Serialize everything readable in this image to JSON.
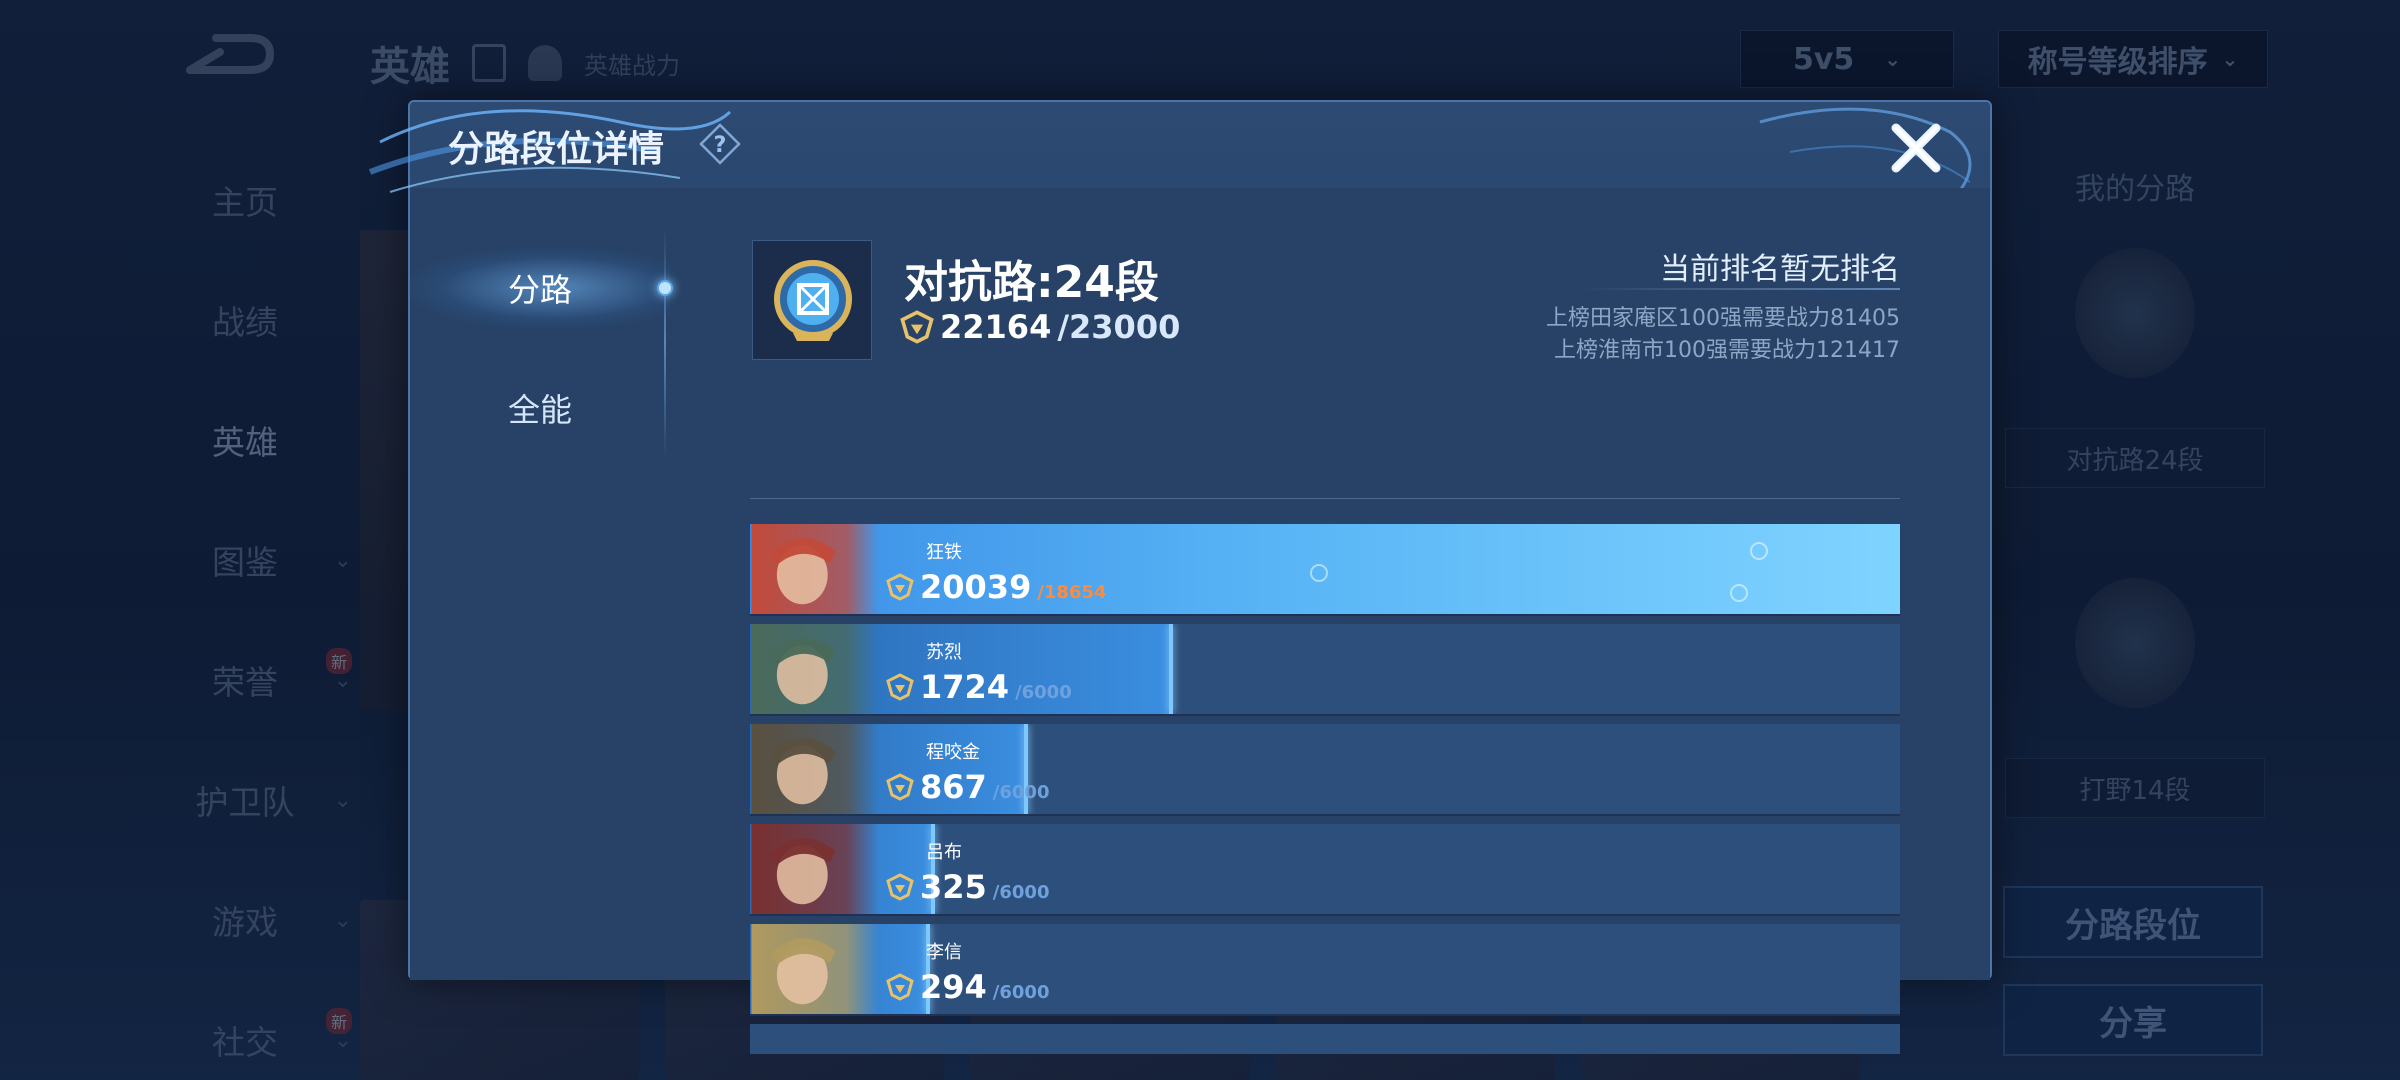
{
  "background": {
    "top_title": "英雄",
    "top_subtitle": "英雄战力",
    "mode_dropdown": "5v5",
    "sort_dropdown": "称号等级排序",
    "nav": [
      {
        "label": "主页",
        "chevron": false,
        "badge": ""
      },
      {
        "label": "战绩",
        "chevron": false,
        "badge": ""
      },
      {
        "label": "英雄",
        "chevron": false,
        "badge": ""
      },
      {
        "label": "图鉴",
        "chevron": true,
        "badge": ""
      },
      {
        "label": "荣誉",
        "chevron": true,
        "badge": "新"
      },
      {
        "label": "护卫队",
        "chevron": true,
        "badge": ""
      },
      {
        "label": "游戏",
        "chevron": true,
        "badge": ""
      },
      {
        "label": "社交",
        "chevron": true,
        "badge": "新"
      }
    ],
    "right_panel": {
      "title": "我的分路",
      "lane1": "对抗路24段",
      "lane2": "打野14段",
      "btn_lane_rank": "分路段位",
      "btn_share": "分享"
    }
  },
  "modal": {
    "title": "分路段位详情",
    "tabs": [
      {
        "label": "分路",
        "active": true
      },
      {
        "label": "全能",
        "active": false
      }
    ],
    "rank": {
      "title": "对抗路:24段",
      "power": "22164",
      "power_max": "/23000",
      "status": "当前排名暂无排名",
      "requirements": [
        "上榜田家庵区100强需要战力81405",
        "上榜淮南市100强需要战力121417"
      ]
    },
    "heroes": [
      {
        "name": "狂铁",
        "score": "20039",
        "max": "/18654",
        "progress": 1.0,
        "color": "#c24a3a"
      },
      {
        "name": "苏烈",
        "score": "1724",
        "max": "/6000",
        "progress": 0.287,
        "color": "#4a6a5a"
      },
      {
        "name": "程咬金",
        "score": "867",
        "max": "/6000",
        "progress": 0.145,
        "color": "#5a5040"
      },
      {
        "name": "吕布",
        "score": "325",
        "max": "/6000",
        "progress": 0.054,
        "color": "#7a3030"
      },
      {
        "name": "李信",
        "score": "294",
        "max": "/6000",
        "progress": 0.049,
        "color": "#b09a60"
      }
    ]
  }
}
